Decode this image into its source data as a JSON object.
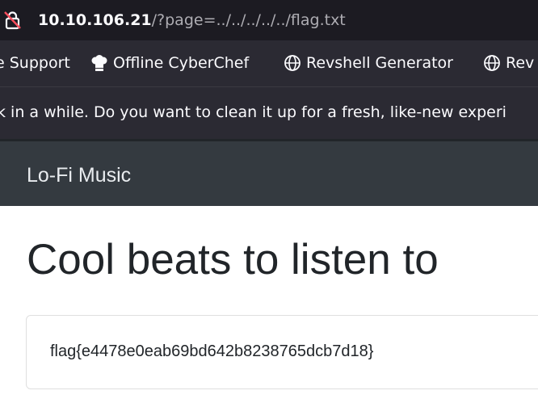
{
  "browser": {
    "url_host": "10.10.106.21",
    "url_path": "/?page=../../../../../flag.txt",
    "bookmarks": [
      {
        "label": "e Support",
        "icon": "none"
      },
      {
        "label": "Offline CyberChef",
        "icon": "chef-hat-icon"
      },
      {
        "label": "Revshell Generator",
        "icon": "globe-icon"
      },
      {
        "label": "Rev",
        "icon": "globe-icon"
      }
    ],
    "notification": "k in a while. Do you want to clean it up for a fresh, like-new experi"
  },
  "page": {
    "brand": "Lo-Fi Music",
    "heading": "Cool beats to listen to",
    "card_text": "flag{e4478e0eab69bd642b8238765dcb7d18}"
  },
  "colors": {
    "url_bar_bg": "#1c1b22",
    "toolbar_bg": "#2b2a33",
    "navbar_bg": "#343a40",
    "lock_warning": "#ff4f5e"
  }
}
